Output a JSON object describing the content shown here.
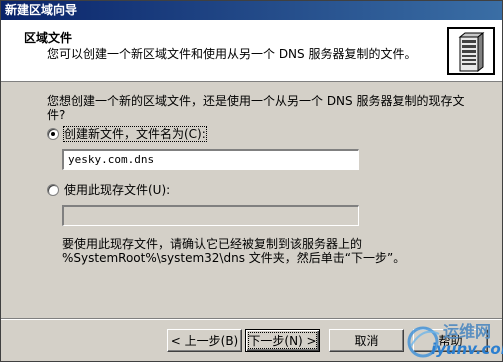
{
  "window": {
    "title": "新建区域向导"
  },
  "header": {
    "title": "区域文件",
    "subtitle": "您可以创建一个新区域文件和使用从另一个 DNS 服务器复制的文件。",
    "icon": "server-icon"
  },
  "content": {
    "question": "您想创建一个新的区域文件，还是使用一个从另一个 DNS 服务器复制的现存文件?",
    "option_new": {
      "label": "创建新文件，文件名为(C):",
      "selected": true,
      "value": "yesky.com.dns"
    },
    "option_existing": {
      "label": "使用此现存文件(U):",
      "selected": false,
      "value": ""
    },
    "note": "要使用此现存文件，请确认它已经被复制到该服务器上的 %SystemRoot%\\system32\\dns 文件夹，然后单击“下一步”。"
  },
  "buttons": {
    "back": "< 上一步(B)",
    "next": "下一步(N) >",
    "cancel": "取消",
    "help": "帮助"
  },
  "watermark": {
    "line1": "运维网",
    "line2": "iyunv.com"
  }
}
